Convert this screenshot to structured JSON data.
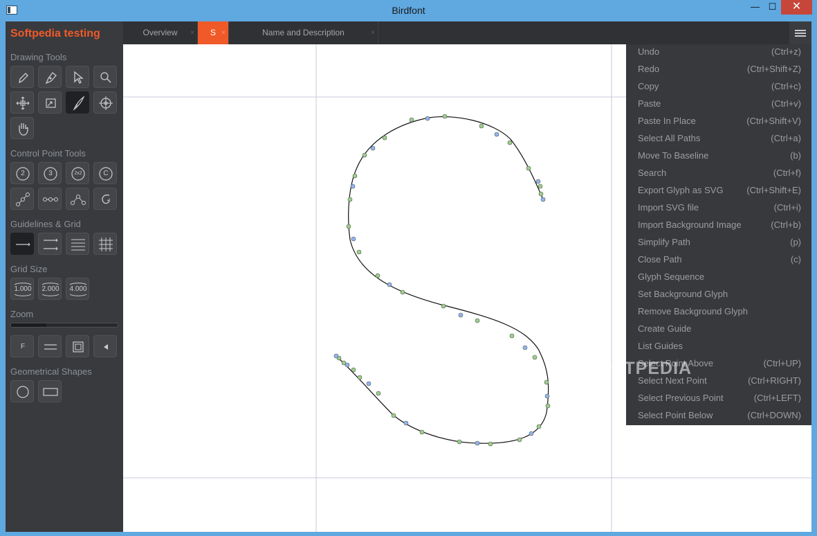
{
  "window": {
    "title": "Birdfont",
    "minimize": "—",
    "maximize": "☐",
    "close": "✕"
  },
  "sidebar": {
    "brand": "Softpedia testing",
    "sections": {
      "drawing_tools": "Drawing Tools",
      "control_point_tools": "Control Point Tools",
      "guidelines_grid": "Guidelines & Grid",
      "grid_size": "Grid Size",
      "zoom": "Zoom",
      "geometrical_shapes": "Geometrical Shapes"
    },
    "grid_sizes": [
      "1.000",
      "2.000",
      "4.000"
    ],
    "control_points": [
      "2",
      "3",
      "2x2",
      "C"
    ],
    "zoom_level_fraction": 0.33,
    "zoom_buttons": [
      "F"
    ]
  },
  "tabs": [
    {
      "label": "Overview",
      "close": "×"
    },
    {
      "label": "S",
      "close": "×"
    },
    {
      "label": "Name and Description",
      "close": "×"
    }
  ],
  "menu": [
    {
      "label": "Undo",
      "shortcut": "(Ctrl+z)"
    },
    {
      "label": "Redo",
      "shortcut": "(Ctrl+Shift+Z)"
    },
    {
      "label": "Copy",
      "shortcut": "(Ctrl+c)"
    },
    {
      "label": "Paste",
      "shortcut": "(Ctrl+v)"
    },
    {
      "label": "Paste In Place",
      "shortcut": "(Ctrl+Shift+V)"
    },
    {
      "label": "Select All Paths",
      "shortcut": "(Ctrl+a)"
    },
    {
      "label": "Move To Baseline",
      "shortcut": "(b)"
    },
    {
      "label": "Search",
      "shortcut": "(Ctrl+f)"
    },
    {
      "label": "Export Glyph as SVG",
      "shortcut": "(Ctrl+Shift+E)"
    },
    {
      "label": "Import SVG file",
      "shortcut": "(Ctrl+i)"
    },
    {
      "label": "Import Background Image",
      "shortcut": "(Ctrl+b)"
    },
    {
      "label": "Simplify Path",
      "shortcut": "(p)"
    },
    {
      "label": "Close Path",
      "shortcut": "(c)"
    },
    {
      "label": "Glyph Sequence",
      "shortcut": ""
    },
    {
      "label": "Set Background Glyph",
      "shortcut": ""
    },
    {
      "label": "Remove Background Glyph",
      "shortcut": ""
    },
    {
      "label": "Create Guide",
      "shortcut": ""
    },
    {
      "label": "List Guides",
      "shortcut": ""
    },
    {
      "label": "Select Point Above",
      "shortcut": "(Ctrl+UP)"
    },
    {
      "label": "Select Next Point",
      "shortcut": "(Ctrl+RIGHT)"
    },
    {
      "label": "Select Previous Point",
      "shortcut": "(Ctrl+LEFT)"
    },
    {
      "label": "Select Point Below",
      "shortcut": "(Ctrl+DOWN)"
    }
  ],
  "watermark": "SOFTPEDIA",
  "colors": {
    "accent": "#f05a28",
    "sidebar": "#383a3e",
    "guide": "#c8c9de",
    "point_green": "#9bd08a",
    "point_blue": "#8fb6f0"
  }
}
